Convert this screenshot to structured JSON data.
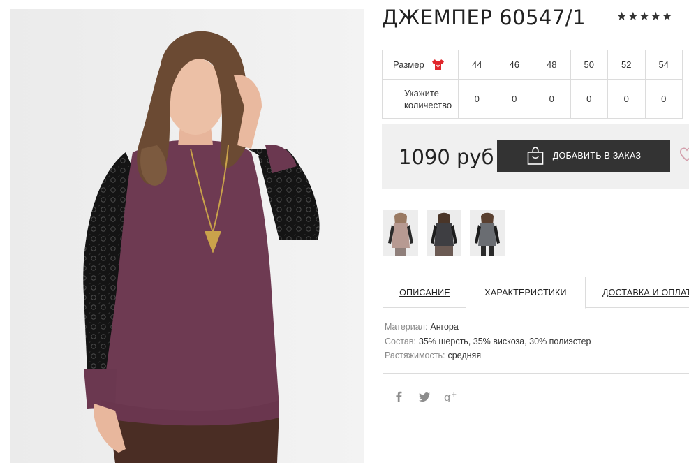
{
  "product": {
    "title": "ДЖЕМПЕР 60547/1",
    "rating_stars": "★★★★★",
    "rating_value": 5
  },
  "size_table": {
    "size_label": "Размер",
    "qty_label_line1": "Укажите",
    "qty_label_line2": "количество",
    "sizes": [
      "44",
      "46",
      "48",
      "50",
      "52",
      "54"
    ],
    "quantities": [
      "0",
      "0",
      "0",
      "0",
      "0",
      "0"
    ]
  },
  "purchase": {
    "price": "1090 руб",
    "add_button_label": "ДОБАВИТЬ В ЗАКАЗ"
  },
  "tabs": [
    {
      "label": "ОПИСАНИЕ",
      "active": false
    },
    {
      "label": "ХАРАКТЕРИСТИКИ",
      "active": true
    },
    {
      "label": "ДОСТАВКА И ОПЛАТА",
      "active": false
    }
  ],
  "specs": [
    {
      "key": "Материал:",
      "value": "Ангора"
    },
    {
      "key": "Состав:",
      "value": "35% шерсть, 35% вискоза, 30% полиэстер"
    },
    {
      "key": "Растяжимость:",
      "value": "средняя"
    }
  ],
  "social": [
    "facebook-icon",
    "twitter-icon",
    "google-plus-icon"
  ],
  "thumbnails": [
    "beige-gray",
    "dark-gray",
    "gray-stripe"
  ],
  "colors": {
    "sweater": "#6e3a52",
    "button_bg": "#333333",
    "buy_box_bg": "#f0f0f0",
    "shirt_icon": "#e0262b",
    "heart": "#d4a0ad"
  }
}
